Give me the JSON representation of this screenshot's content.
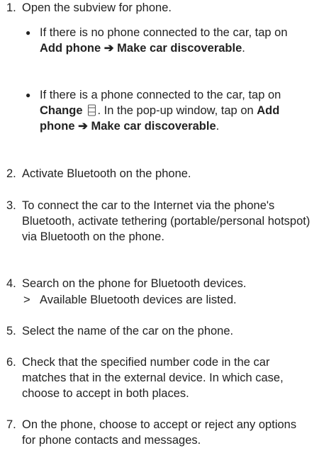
{
  "step1": {
    "num": "1.",
    "text": "Open the subview for phone.",
    "bullet_a": {
      "prefix": "If there is no phone connected to the car, tap on ",
      "add_phone": "Add phone",
      "arrow": "➔",
      "make_discoverable": "Make car discoverable",
      "suffix": "."
    },
    "bullet_b": {
      "prefix": "If there is a phone connected to the car, tap on ",
      "change": "Change",
      "icon_name": "phone-change-icon",
      "middle": ". In the pop-up window, tap on ",
      "add_phone": "Add phone",
      "arrow": "➔",
      "make_discoverable": "Make car discoverable",
      "suffix": "."
    }
  },
  "step2": {
    "num": "2.",
    "text": "Activate Bluetooth on the phone."
  },
  "step3": {
    "num": "3.",
    "text": "To connect the car to the Internet via the phone's Bluetooth, activate tethering (portable/personal hotspot) via Bluetooth on the phone."
  },
  "step4": {
    "num": "4.",
    "text": "Search on the phone for Bluetooth devices.",
    "result_mark": ">",
    "result": "Available Bluetooth devices are listed."
  },
  "step5": {
    "num": "5.",
    "text": "Select the name of the car on the phone."
  },
  "step6": {
    "num": "6.",
    "text": "Check that the specified number code in the car matches that in the external device. In which case, choose to accept in both places."
  },
  "step7": {
    "num": "7.",
    "text": "On the phone, choose to accept or reject any options for phone contacts and messages."
  }
}
